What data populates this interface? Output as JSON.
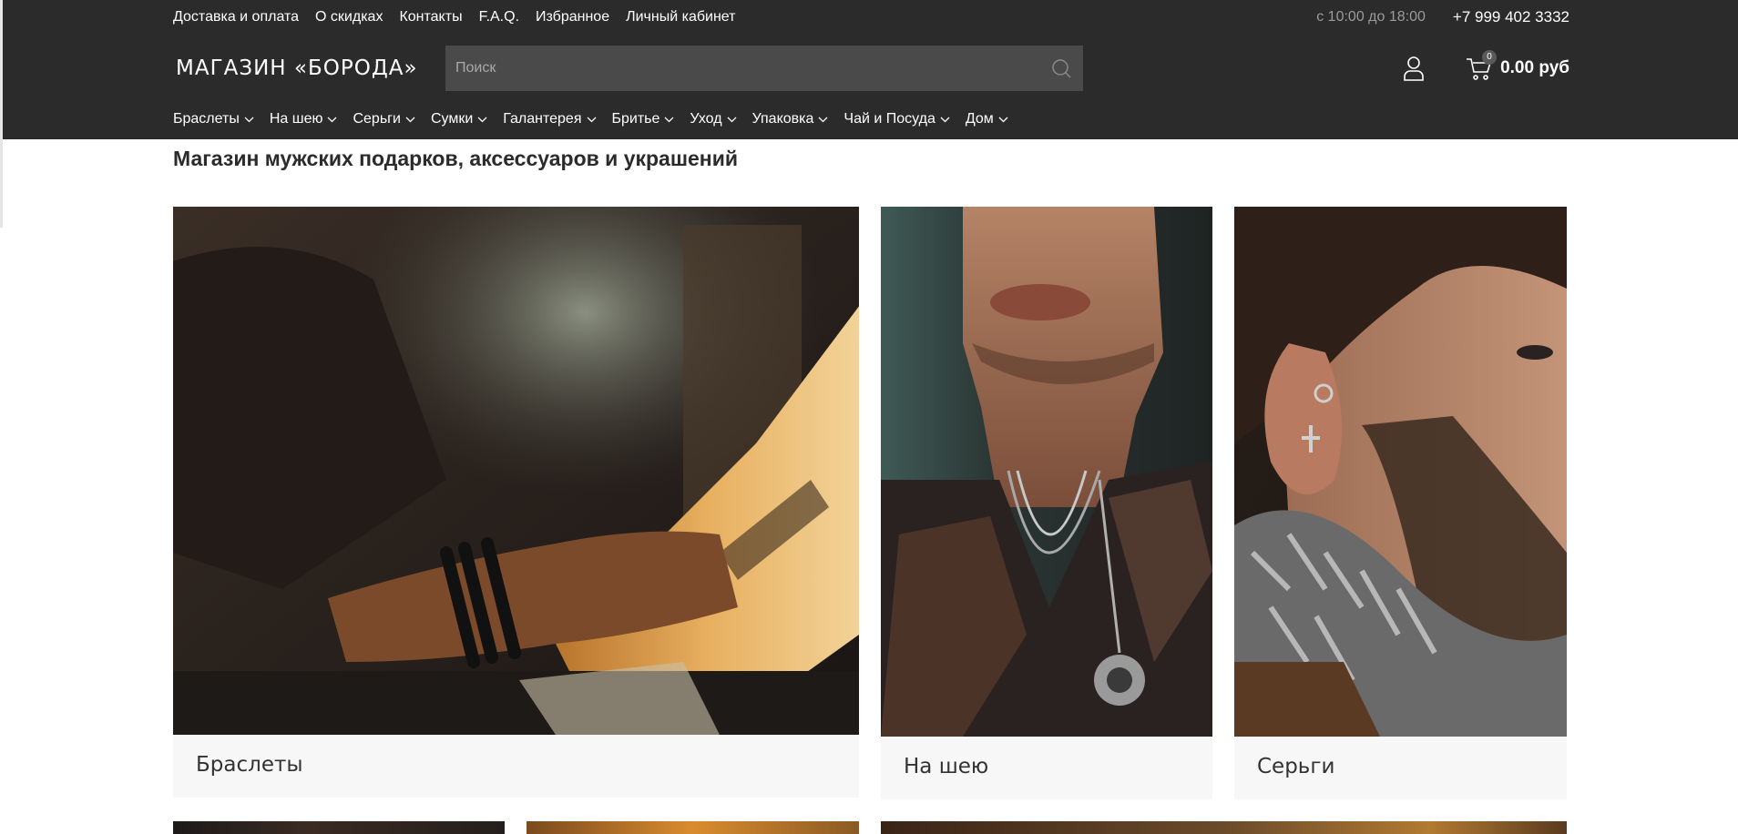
{
  "topbar": {
    "links": [
      "Доставка и оплата",
      "О скидках",
      "Контакты",
      "F.A.Q.",
      "Избранное",
      "Личный кабинет"
    ],
    "hours": "с 10:00 до 18:00",
    "phone": "+7 999 402 3332"
  },
  "header": {
    "logo": "МАГАЗИН «БОРОДА»",
    "search_placeholder": "Поиск",
    "cart_count": "0",
    "cart_total": "0.00 руб",
    "icons": {
      "search": "search-icon",
      "user": "user-icon",
      "cart": "cart-icon",
      "dropdown": "chevron-down-icon"
    }
  },
  "categories": [
    "Браслеты",
    "На шею",
    "Серьги",
    "Сумки",
    "Галантерея",
    "Бритье",
    "Уход",
    "Упаковка",
    "Чай и Посуда",
    "Дом"
  ],
  "main": {
    "title": "Магазин мужских подарков, аксессуаров и украшений",
    "cards": [
      {
        "label": "Браслеты"
      },
      {
        "label": "На шею"
      },
      {
        "label": "Серьги"
      }
    ]
  },
  "colors": {
    "header_bg": "#2b2b2b",
    "search_bg": "#4a4a4a",
    "card_bg": "#f7f7f7",
    "text_dark": "#2b2b2b"
  }
}
